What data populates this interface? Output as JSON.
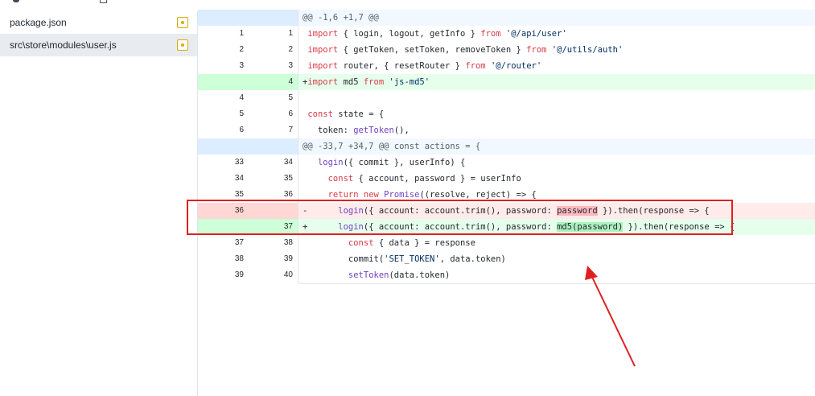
{
  "files": [
    {
      "name": "package.json",
      "status_icon": "modified-icon",
      "active": false
    },
    {
      "name": "src\\store\\modules\\user.js",
      "status_icon": "modified-icon",
      "active": true
    }
  ],
  "colors": {
    "added_bg": "#e6ffec",
    "deleted_bg": "#ffebe9",
    "hunk_bg": "#f1f8ff",
    "annotation": "#e02020",
    "modified_badge": "#dbab09"
  },
  "diff": {
    "rows": [
      {
        "type": "hunk",
        "old": "",
        "new": "",
        "code": "@@ -1,6 +1,7 @@"
      },
      {
        "type": "ctx",
        "old": "1",
        "new": "1",
        "code": " import { login, logout, getInfo } from '@/api/user'"
      },
      {
        "type": "ctx",
        "old": "2",
        "new": "2",
        "code": " import { getToken, setToken, removeToken } from '@/utils/auth'"
      },
      {
        "type": "ctx",
        "old": "3",
        "new": "3",
        "code": " import router, { resetRouter } from '@/router'"
      },
      {
        "type": "add",
        "old": "",
        "new": "4",
        "code": "+import md5 from 'js-md5'"
      },
      {
        "type": "ctx",
        "old": "4",
        "new": "5",
        "code": ""
      },
      {
        "type": "ctx",
        "old": "5",
        "new": "6",
        "code": " const state = {"
      },
      {
        "type": "ctx",
        "old": "6",
        "new": "7",
        "code": "   token: getToken(),"
      },
      {
        "type": "hunk",
        "old": "",
        "new": "",
        "code": "@@ -33,7 +34,7 @@ const actions = {"
      },
      {
        "type": "ctx",
        "old": "33",
        "new": "34",
        "code": "   login({ commit }, userInfo) {"
      },
      {
        "type": "ctx",
        "old": "34",
        "new": "35",
        "code": "     const { account, password } = userInfo"
      },
      {
        "type": "ctx",
        "old": "35",
        "new": "36",
        "code": "     return new Promise((resolve, reject) => {"
      },
      {
        "type": "del",
        "old": "36",
        "new": "",
        "code": "-      login({ account: account.trim(), password: password }).then(response => {"
      },
      {
        "type": "add",
        "old": "",
        "new": "37",
        "code": "+      login({ account: account.trim(), password: md5(password) }).then(response => {"
      },
      {
        "type": "ctx",
        "old": "37",
        "new": "38",
        "code": "         const { data } = response"
      },
      {
        "type": "ctx",
        "old": "38",
        "new": "39",
        "code": "         commit('SET_TOKEN', data.token)"
      },
      {
        "type": "ctx",
        "old": "39",
        "new": "40",
        "code": "         setToken(data.token)"
      }
    ]
  }
}
